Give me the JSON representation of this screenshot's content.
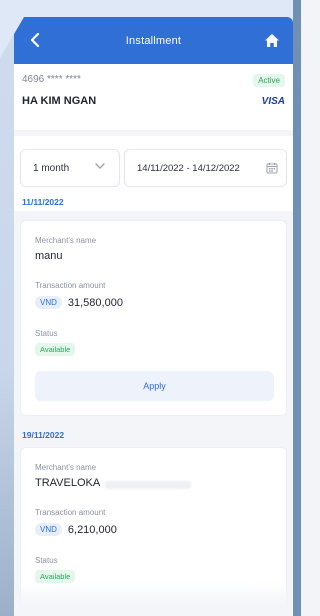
{
  "header": {
    "title": "Installment"
  },
  "card": {
    "number": "4696 **** ****",
    "holder": "HA KIM NGAN",
    "status": "Active",
    "brand": "VISA"
  },
  "filter": {
    "period": "1 month",
    "date_range": "14/11/2022 - 14/12/2022"
  },
  "transactions": [
    {
      "date": "11/11/2022",
      "merchant_label": "Merchant's name",
      "merchant": "manu",
      "amount_label": "Transaction amount",
      "currency": "VND",
      "amount": "31,580,000",
      "status_label": "Status",
      "status": "Available",
      "action": "Apply"
    },
    {
      "date": "19/11/2022",
      "merchant_label": "Merchant's name",
      "merchant": "TRAVELOKA",
      "amount_label": "Transaction amount",
      "currency": "VND",
      "amount": "6,210,000",
      "status_label": "Status",
      "status": "Available"
    }
  ],
  "colors": {
    "primary": "#2f6fd6",
    "success": "#2aa65c",
    "background": "#f4f5f9"
  },
  "icons": {
    "back": "chevron-left-icon",
    "home": "home-icon",
    "dropdown": "chevron-down-icon",
    "calendar": "calendar-icon"
  }
}
